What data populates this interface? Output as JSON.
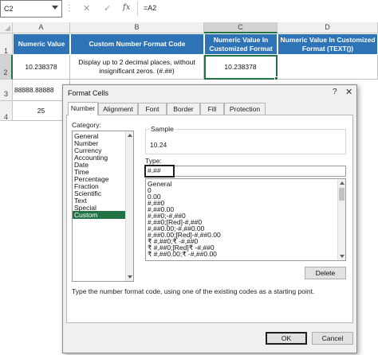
{
  "formula_bar": {
    "name_box": "C2",
    "cancel": "✕",
    "enter": "✓",
    "fx": "fx",
    "formula": "=A2"
  },
  "grid": {
    "columns": [
      "A",
      "B",
      "C",
      "D"
    ],
    "rows": [
      "1",
      "2",
      "3",
      "4"
    ],
    "headers": [
      "Numeric Value",
      "Custom Number Format Code",
      "Numeric Value In Customized Format",
      "Numeric Value In Customized Format (TEXT())"
    ],
    "row2": {
      "a": "10.238378",
      "b": "Display up to 2 decimal places, without insignificant zeros. (#.##)",
      "c": "10.238378",
      "d": ""
    },
    "row3": {
      "a": "88888.88888"
    },
    "row4": {
      "a": "25"
    }
  },
  "dialog": {
    "title": "Format Cells",
    "help": "?",
    "close": "✕",
    "tabs": [
      "Number",
      "Alignment",
      "Font",
      "Border",
      "Fill",
      "Protection"
    ],
    "active_tab": "Number",
    "category_label": "Category:",
    "categories": [
      "General",
      "Number",
      "Currency",
      "Accounting",
      "Date",
      "Time",
      "Percentage",
      "Fraction",
      "Scientific",
      "Text",
      "Special",
      "Custom"
    ],
    "selected_category": "Custom",
    "sample_label": "Sample",
    "sample_value": "10.24",
    "type_label": "Type:",
    "type_value": "#.##",
    "formats": [
      "General",
      "0",
      "0.00",
      "#,##0",
      "#,##0.00",
      "#,##0;-#,##0",
      "#,##0;[Red]-#,##0",
      "#,##0.00;-#,##0.00",
      "#,##0.00;[Red]-#,##0.00",
      "₹ #,##0;₹ -#,##0",
      "₹ #,##0;[Red]₹ -#,##0",
      "₹ #,##0.00;₹ -#,##0.00"
    ],
    "delete_button": "Delete",
    "description": "Type the number format code, using one of the existing codes as a starting point.",
    "ok_button": "OK",
    "cancel_button": "Cancel"
  },
  "colors": {
    "header_fill": "#2e73b6",
    "selection_green": "#217346",
    "dialog_bg": "#f0f0f0"
  },
  "icons": {
    "name_box_dropdown": "chevron-down-icon",
    "select_all": "select-all-triangle-icon"
  }
}
